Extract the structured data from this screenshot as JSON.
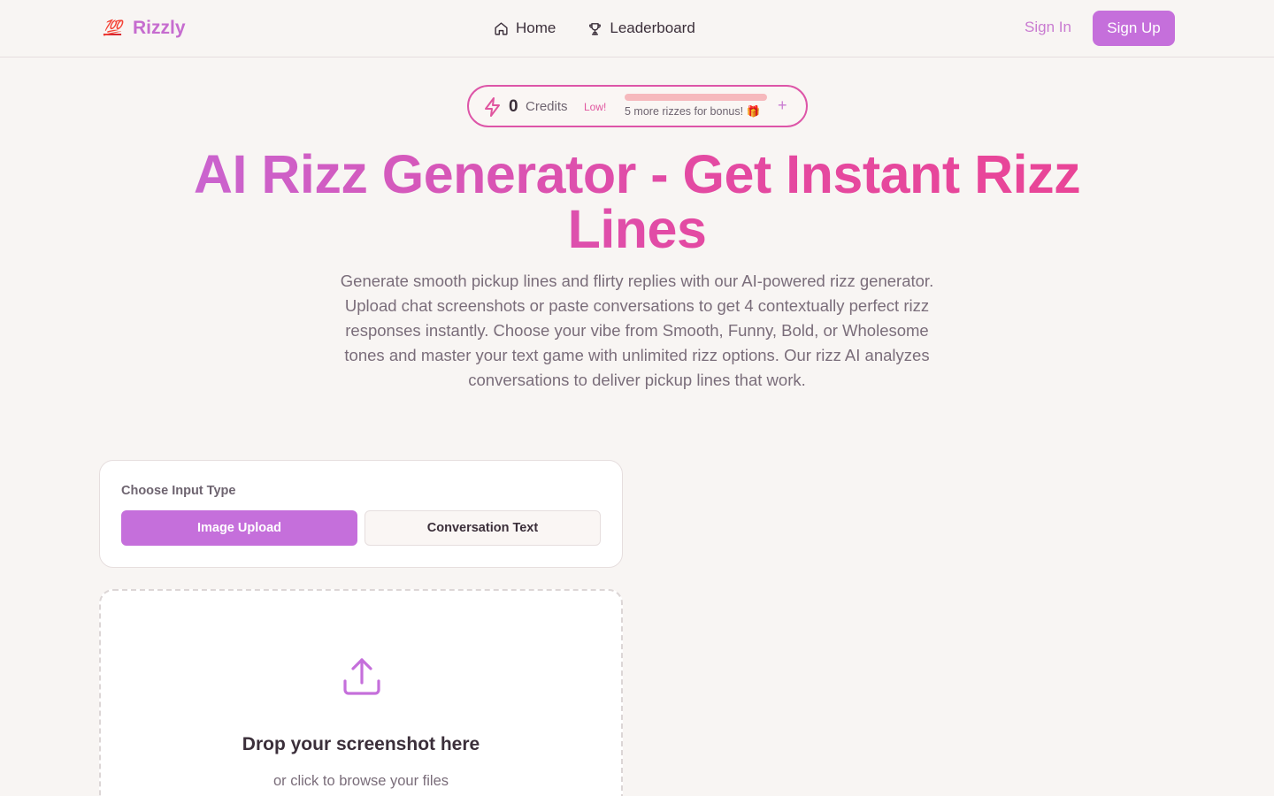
{
  "header": {
    "brand_logo": "💯",
    "brand_name": "Rizzly",
    "nav": [
      {
        "label": "Home",
        "icon": "home-icon"
      },
      {
        "label": "Leaderboard",
        "icon": "trophy-icon"
      }
    ],
    "sign_in": "Sign In",
    "sign_up": "Sign Up"
  },
  "credits": {
    "count": "0",
    "label": "Credits",
    "status": "Low!",
    "progress_fraction": 0.0,
    "bonus_text": "5 more rizzes for bonus!",
    "bonus_icon": "🎁",
    "add_label": "+"
  },
  "hero": {
    "title": "AI Rizz Generator - Get Instant Rizz Lines",
    "description": "Generate smooth pickup lines and flirty replies with our AI-powered rizz generator. Upload chat screenshots or paste conversations to get 4 contextually perfect rizz responses instantly. Choose your vibe from Smooth, Funny, Bold, or Wholesome tones and master your text game with unlimited rizz options. Our rizz AI analyzes conversations to deliver pickup lines that work."
  },
  "input_type": {
    "label": "Choose Input Type",
    "options": [
      "Image Upload",
      "Conversation Text"
    ],
    "selected": "Image Upload"
  },
  "dropzone": {
    "title": "Drop your screenshot here",
    "subtitle": "or click to browse your files"
  },
  "colors": {
    "accent": "#c56fdb",
    "pink": "#e34aa3",
    "background": "#f8f5f3",
    "text": "#3b2f3a"
  }
}
